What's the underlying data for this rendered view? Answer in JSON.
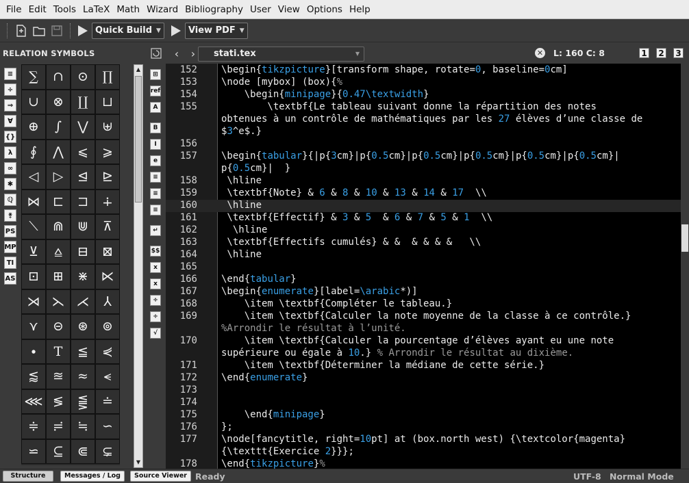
{
  "menu": [
    "File",
    "Edit",
    "Tools",
    "LaTeX",
    "Math",
    "Wizard",
    "Bibliography",
    "User",
    "View",
    "Options",
    "Help"
  ],
  "toolbar": {
    "build_label": "Quick Build",
    "view_label": "View PDF"
  },
  "left_panel": {
    "title": "RELATION SYMBOLS",
    "categories": [
      "≡",
      "÷",
      "⇒",
      "∀",
      "{}",
      "λ",
      "∞",
      "✱",
      "ℚ",
      "⚵",
      "PS",
      "MP",
      "TI",
      "AS"
    ],
    "symbols": [
      "∑",
      "∩",
      "⊙",
      "∏",
      "∪",
      "⊗",
      "∐",
      "⊔",
      "⊕",
      "∫",
      "⋁",
      "⊎",
      "∮",
      "⋀",
      "⩽",
      "⩾",
      "◁",
      "▷",
      "⊴",
      "⊵",
      "⋈",
      "⊏",
      "⊐",
      "∔",
      "⟍",
      "⋒",
      "⋓",
      "⊼",
      "⊻",
      "⩠",
      "⊟",
      "⊠",
      "⊡",
      "⊞",
      "⋇",
      "⋉",
      "⋊",
      "⋋",
      "⋌",
      "⅄",
      "⋎",
      "⊝",
      "⊛",
      "⊚",
      "∙",
      "T",
      "≦",
      "⋞",
      "⪅",
      "≊",
      "≈",
      "⪪",
      "⋘",
      "≶",
      "⪋",
      "≐",
      "≑",
      "≓",
      "≒",
      "∽",
      "⋍",
      "⊆",
      "⋐",
      "⊊"
    ]
  },
  "editor": {
    "tab_name": "stati.tex",
    "cursor_position": "L: 160 C: 8",
    "view_buttons": [
      "1",
      "2",
      "3"
    ]
  },
  "status": {
    "tabs": [
      "Structure",
      "Messages / Log",
      "Source Viewer"
    ],
    "state": "Ready",
    "encoding": "UTF-8",
    "mode": "Normal Mode"
  },
  "code_lines": [
    {
      "n": "152",
      "t": "\\begin{tikzpicture}[transform shape, rotate=0, baseline=0cm]"
    },
    {
      "n": "153",
      "t": "\\node [mybox] (box){%"
    },
    {
      "n": "154",
      "t": "    \\begin{minipage}{0.47\\textwidth}"
    },
    {
      "n": "155",
      "t": "        \\textbf{Le tableau suivant donne la répartition des notes"
    },
    {
      "n": "",
      "t": "obtenues à un contrôle de mathématiques par les 27 élèves d’une classe de"
    },
    {
      "n": "",
      "t": "$3^e$.}"
    },
    {
      "n": "156",
      "t": ""
    },
    {
      "n": "157",
      "t": "\\begin{tabular}{|p{3cm}|p{0.5cm}|p{0.5cm}|p{0.5cm}|p{0.5cm}|p{0.5cm}|"
    },
    {
      "n": "",
      "t": "p{0.5cm}|  }"
    },
    {
      "n": "158",
      "t": " \\hline"
    },
    {
      "n": "159",
      "t": " \\textbf{Note} & 6 & 8 & 10 & 13 & 14 & 17  \\\\"
    },
    {
      "n": "160",
      "t": " \\hline"
    },
    {
      "n": "161",
      "t": " \\textbf{Effectif} & 3 & 5  & 6 & 7 & 5 & 1  \\\\"
    },
    {
      "n": "162",
      "t": "  \\hline"
    },
    {
      "n": "163",
      "t": " \\textbf{Effectifs cumulés} & &  & & & &   \\\\"
    },
    {
      "n": "164",
      "t": " \\hline"
    },
    {
      "n": "165",
      "t": ""
    },
    {
      "n": "166",
      "t": "\\end{tabular}"
    },
    {
      "n": "167",
      "t": "\\begin{enumerate}[label=\\arabic*)]"
    },
    {
      "n": "168",
      "t": "    \\item \\textbf{Compléter le tableau.}"
    },
    {
      "n": "169",
      "t": "    \\item \\textbf{Calculer la note moyenne de la classe à ce contrôle.}"
    },
    {
      "n": "",
      "t": "%Arrondir le résultat à l’unité."
    },
    {
      "n": "170",
      "t": "    \\item \\textbf{Calculer la pourcentage d’élèves ayant eu une note"
    },
    {
      "n": "",
      "t": "supérieure ou égale à 10.} % Arrondir le résultat au dixième."
    },
    {
      "n": "171",
      "t": "    \\item \\textbf{Déterminer la médiane de cette série.}"
    },
    {
      "n": "172",
      "t": "\\end{enumerate}"
    },
    {
      "n": "173",
      "t": ""
    },
    {
      "n": "174",
      "t": ""
    },
    {
      "n": "175",
      "t": "    \\end{minipage}"
    },
    {
      "n": "176",
      "t": "};"
    },
    {
      "n": "177",
      "t": "\\node[fancytitle, right=10pt] at (box.north west) {\\textcolor{magenta}"
    },
    {
      "n": "",
      "t": "{\\texttt{Exercice 2}}};"
    },
    {
      "n": "178",
      "t": "\\end{tikzpicture}%"
    }
  ],
  "current_line": "160"
}
